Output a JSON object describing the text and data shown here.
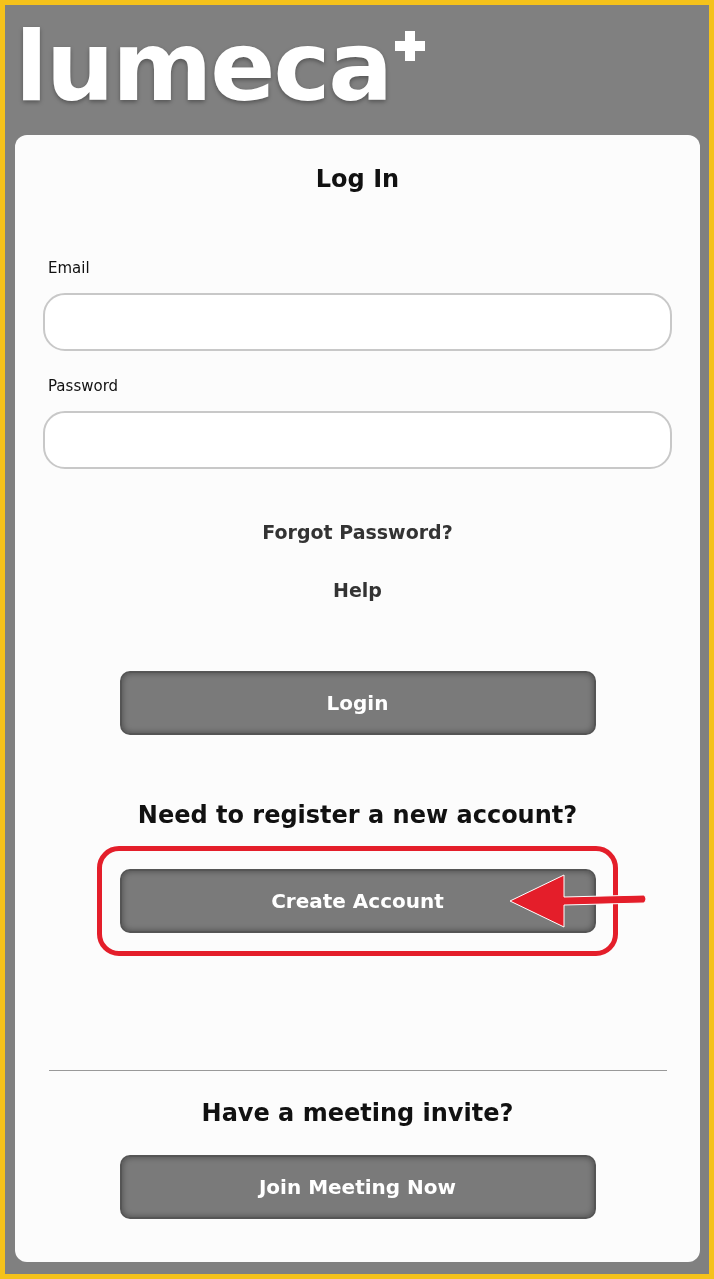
{
  "logo": {
    "text": "lumeca"
  },
  "title": "Log In",
  "fields": [
    {
      "label": "Email"
    },
    {
      "label": "Password"
    }
  ],
  "links": [
    "Forgot Password?",
    "Help"
  ],
  "login_button": "Login",
  "register_prompt": "Need to register a new account?",
  "create_account_button": {
    "label": "Create Account",
    "highlighted": true
  },
  "meeting_prompt": "Have a meeting invite?",
  "join_button": "Join Meeting Now"
}
